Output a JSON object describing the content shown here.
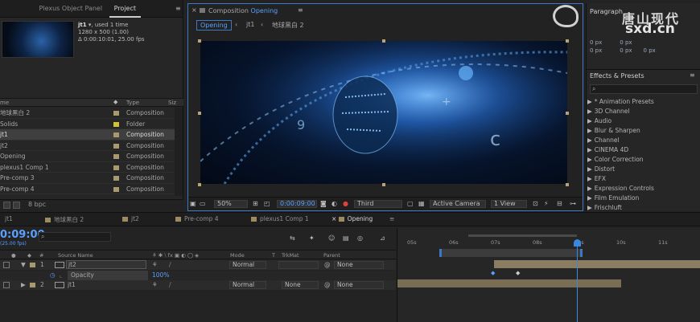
{
  "project": {
    "tabs": [
      "Plexus Object Panel",
      "Project"
    ],
    "comp_name": "jt1",
    "used": ", used 1 time",
    "dims": "1280 x 500 (1.00)",
    "duration": "Δ 0:00:10:01, 25.00 fps",
    "col_name": "me",
    "col_type": "Type",
    "col_size": "Siz",
    "items": [
      {
        "name": "地球黑白 2",
        "type": "Composition",
        "color": "#a8996e"
      },
      {
        "name": "Solids",
        "type": "Folder",
        "color": "#d1c23a"
      },
      {
        "name": "jt1",
        "type": "Composition",
        "color": "#a8996e",
        "selected": true
      },
      {
        "name": "jt2",
        "type": "Composition",
        "color": "#a8996e"
      },
      {
        "name": "Opening",
        "type": "Composition",
        "color": "#a8996e"
      },
      {
        "name": "plexus1 Comp 1",
        "type": "Composition",
        "color": "#a8996e"
      },
      {
        "name": "Pre-comp 3",
        "type": "Composition",
        "color": "#a8996e"
      },
      {
        "name": "Pre-comp 4",
        "type": "Composition",
        "color": "#a8996e"
      }
    ],
    "bpc": "8 bpc"
  },
  "comp": {
    "title_prefix": "Composition",
    "title_name": "Opening",
    "breadcrumbs": [
      "Opening",
      "jt1",
      "地球黑白 2"
    ],
    "zoom": "50%",
    "timecode": "0:00:09:00",
    "resolution": "Third",
    "camera": "Active Camera",
    "view": "1 View"
  },
  "right": {
    "paragraph": "Paragraph",
    "px_values": [
      "0 px",
      "0 px",
      "0 px",
      "0 px",
      "0 px"
    ],
    "watermark": "唐山现代",
    "watermark_sub": "sxd.cn",
    "effects_title": "Effects & Presets",
    "effects": [
      "* Animation Presets",
      "3D Channel",
      "Audio",
      "Blur & Sharpen",
      "Channel",
      "CINEMA 4D",
      "Color Correction",
      "Distort",
      "EFX",
      "Expression Controls",
      "Film Emulation",
      "Frischluft"
    ]
  },
  "timeline": {
    "tabs": [
      "jt1",
      "地球黑白 2",
      "jt2",
      "Pre-comp 4",
      "plexus1 Comp 1",
      "Opening"
    ],
    "active_tab": "Opening",
    "timecode": "0:09:00",
    "fps_note": "(25.00 fps)",
    "headers": {
      "num": "#",
      "source": "Source Name",
      "mode": "Mode",
      "t": "T",
      "trkmat": "TrkMat",
      "parent": "Parent"
    },
    "layers": [
      {
        "num": "1",
        "name": "jt2",
        "mode": "Normal",
        "trkmat": "",
        "parent": "None"
      },
      {
        "num": "2",
        "name": "jt1",
        "mode": "Normal",
        "trkmat": "None",
        "parent": "None"
      }
    ],
    "opacity_label": "Opacity",
    "opacity_value": "100%",
    "ruler": [
      "05s",
      "06s",
      "07s",
      "08s",
      "09s",
      "10s",
      "11s"
    ]
  }
}
